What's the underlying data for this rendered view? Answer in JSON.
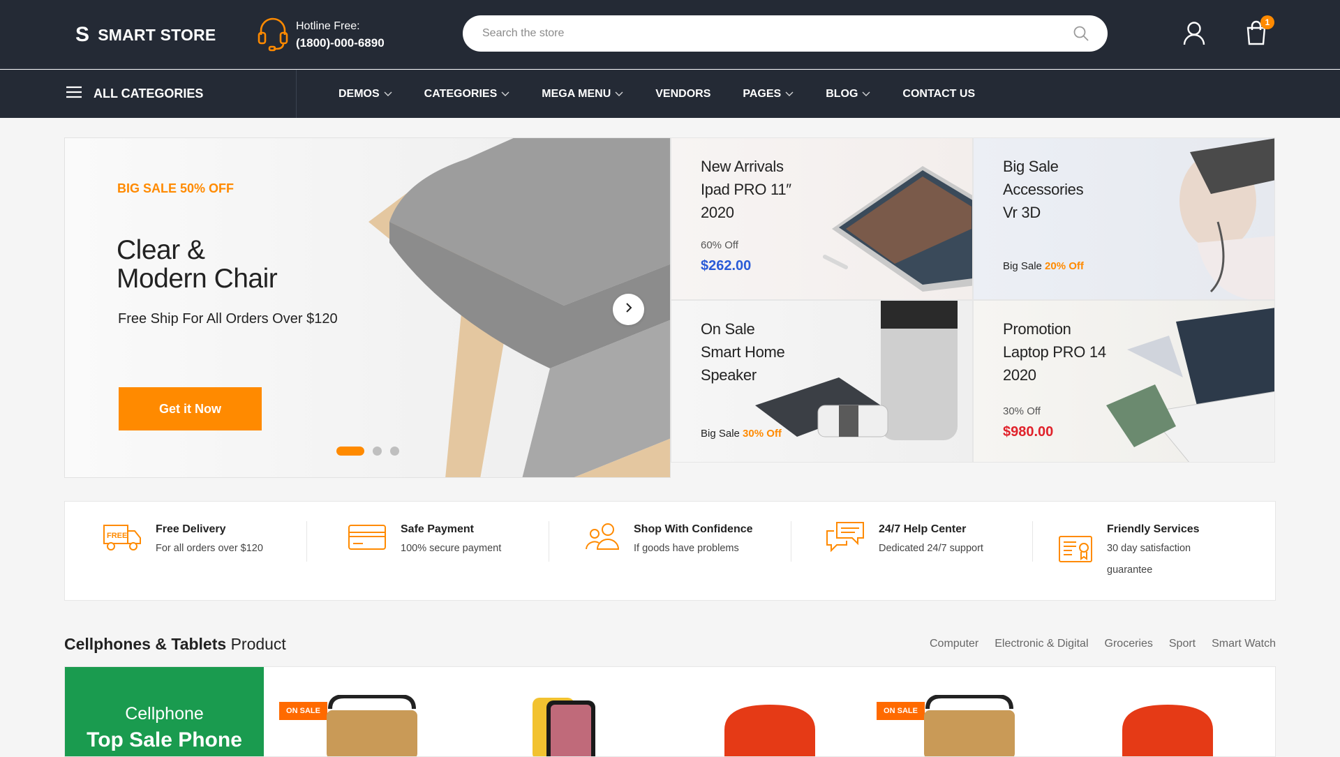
{
  "header": {
    "logo_mark": "S",
    "logo_text": "SMART STORE",
    "hotline_label": "Hotline Free:",
    "hotline_number": "(1800)-000-6890",
    "search_placeholder": "Search the store",
    "cart_count": "1"
  },
  "nav": {
    "all_categories": "ALL CATEGORIES",
    "items": [
      {
        "label": "DEMOS",
        "has_dropdown": true
      },
      {
        "label": "CATEGORIES",
        "has_dropdown": true
      },
      {
        "label": "MEGA MENU",
        "has_dropdown": true
      },
      {
        "label": "VENDORS",
        "has_dropdown": false
      },
      {
        "label": "PAGES",
        "has_dropdown": true
      },
      {
        "label": "BLOG",
        "has_dropdown": true
      },
      {
        "label": "CONTACT US",
        "has_dropdown": false
      }
    ]
  },
  "hero": {
    "sale_label": "BIG SALE 50% OFF",
    "title_line1": "Clear &",
    "title_line2": "Modern Chair",
    "subtitle": "Free Ship For All Orders Over $120",
    "button": "Get it Now",
    "slides": 3,
    "active_slide": 1
  },
  "tiles": [
    {
      "lines": [
        "New Arrivals",
        "Ipad PRO 11″",
        "2020"
      ],
      "off": "60% Off",
      "price": "$262.00",
      "price_color": "#2a5bd7"
    },
    {
      "lines": [
        "Big Sale",
        "Accessories",
        "Vr 3D"
      ],
      "sale_prefix": "Big Sale",
      "sale_pct": "20% Off"
    },
    {
      "lines": [
        "On Sale",
        "Smart Home",
        "Speaker"
      ],
      "sale_prefix": "Big Sale",
      "sale_pct": "30% Off"
    },
    {
      "lines": [
        "Promotion",
        "Laptop PRO 14",
        "2020"
      ],
      "off": "30% Off",
      "price": "$980.00",
      "price_color": "#e0222b"
    }
  ],
  "features": [
    {
      "icon": "free-delivery-icon",
      "title": "Free Delivery",
      "sub": "For all orders over $120"
    },
    {
      "icon": "credit-card-icon",
      "title": "Safe Payment",
      "sub": "100% secure payment"
    },
    {
      "icon": "people-icon",
      "title": "Shop With Confidence",
      "sub": "If goods have problems"
    },
    {
      "icon": "chat-icon",
      "title": "24/7 Help Center",
      "sub": "Dedicated 24/7 support"
    },
    {
      "icon": "certificate-icon",
      "title": "Friendly Services",
      "sub": "30 day satisfaction",
      "sub2": "guarantee"
    }
  ],
  "section": {
    "title_bold": "Cellphones & Tablets",
    "title_rest": "Product",
    "tabs": [
      "Computer",
      "Electronic & Digital",
      "Groceries",
      "Sport",
      "Smart Watch"
    ]
  },
  "promo": {
    "line1": "Cellphone",
    "line2": "Top Sale Phone"
  },
  "onsale_label": "ON SALE",
  "colors": {
    "accent": "#ff8a00",
    "header_bg": "#242a35",
    "promo_green": "#1a9b4f"
  }
}
